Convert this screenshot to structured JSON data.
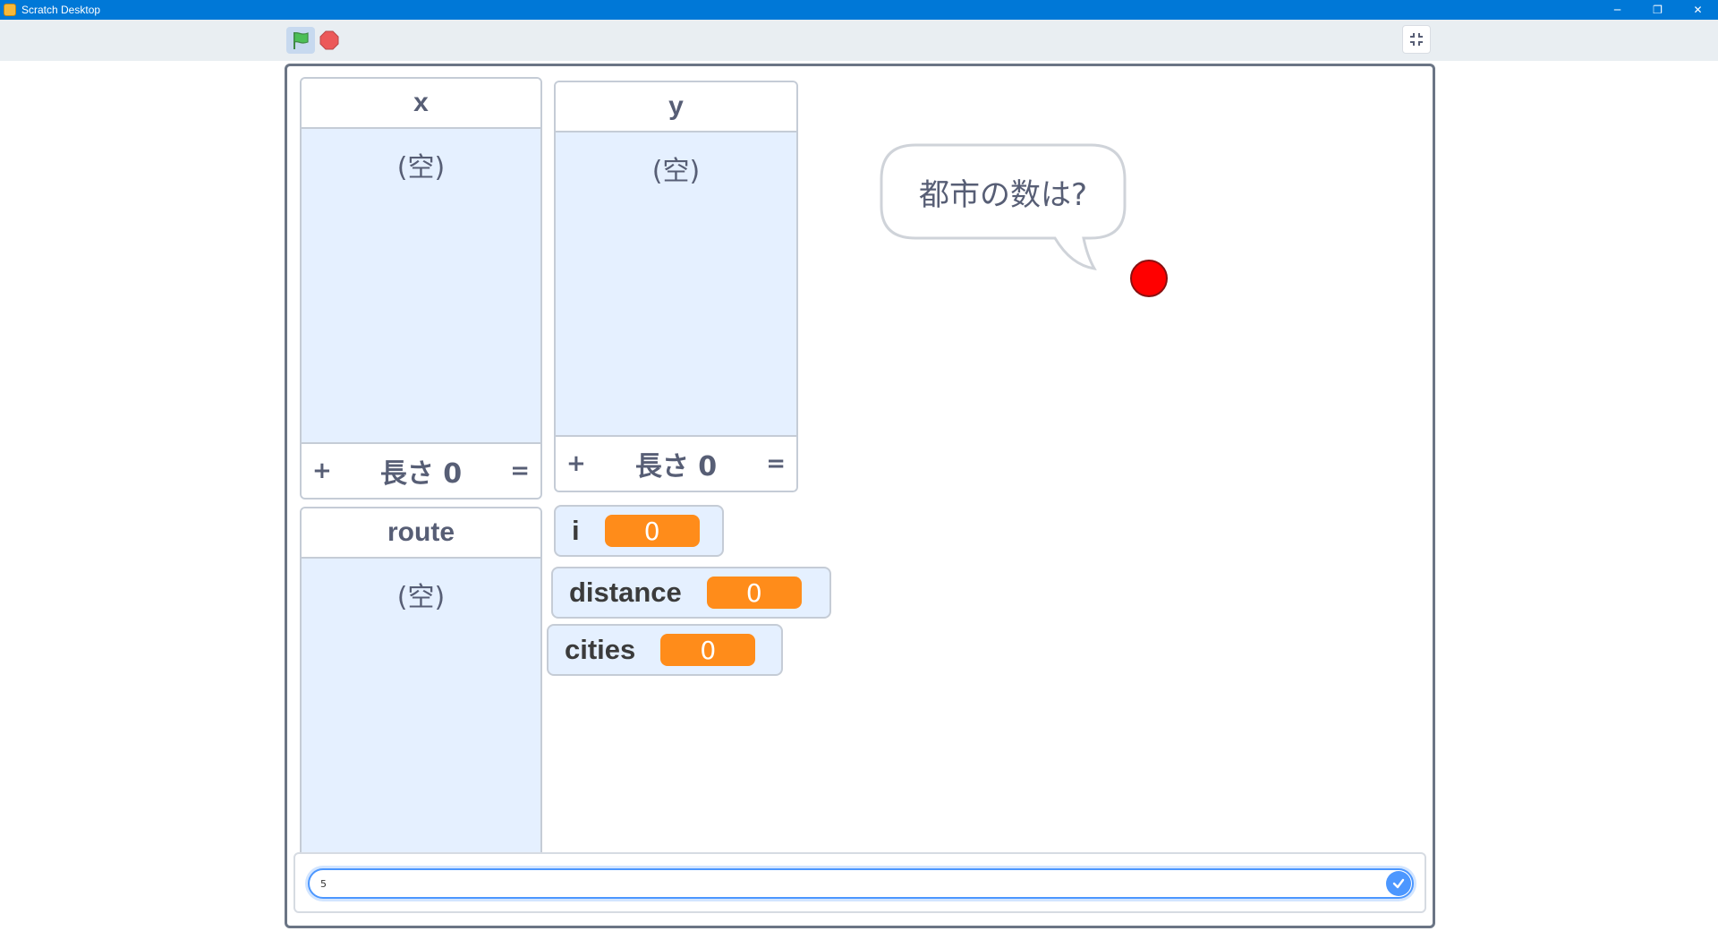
{
  "window": {
    "title": "Scratch Desktop",
    "controls": {
      "minimize": "─",
      "restore": "❐",
      "close": "✕"
    }
  },
  "toolbar": {
    "green_flag_color": "#4cbf56",
    "stop_color": "#ec5959",
    "fullscreen_icon": "shrink-icon"
  },
  "stage": {
    "lists": [
      {
        "name": "x",
        "empty_label": "(空)",
        "plus": "+",
        "length_label": "長さ 0",
        "resize": "="
      },
      {
        "name": "y",
        "empty_label": "(空)",
        "plus": "+",
        "length_label": "長さ 0",
        "resize": "="
      },
      {
        "name": "route",
        "empty_label": "(空)"
      }
    ],
    "variables": [
      {
        "name": "i",
        "value": "0"
      },
      {
        "name": "distance",
        "value": "0"
      },
      {
        "name": "cities",
        "value": "0"
      }
    ],
    "speech_bubble": "都市の数は?",
    "sprite_color": "#ff0000",
    "answer": {
      "value": "5",
      "accent": "#4c97ff"
    }
  }
}
